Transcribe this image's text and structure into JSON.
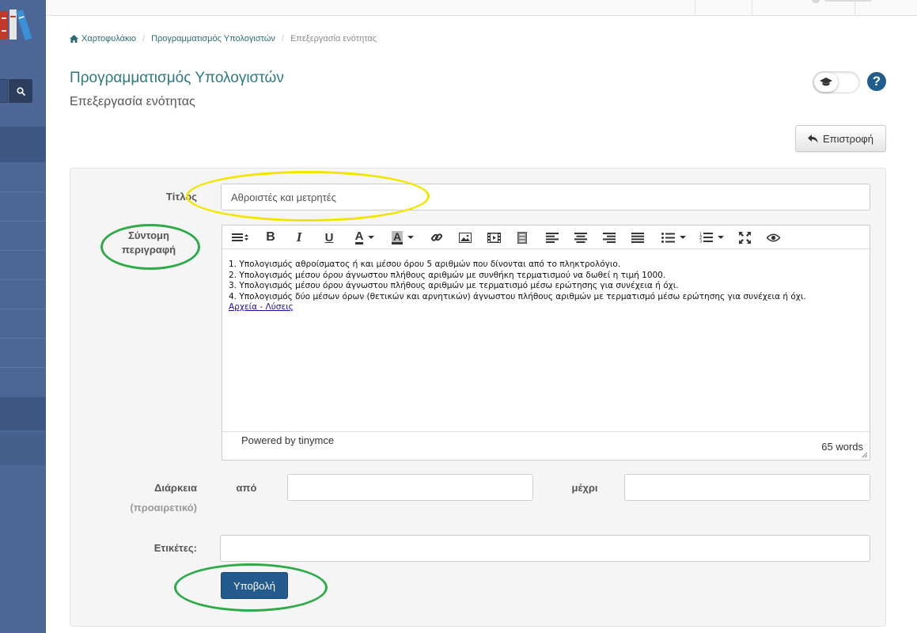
{
  "breadcrumb": {
    "home": "Χαρτοφυλάκιο",
    "course": "Προγραμματισμός Υπολογιστών",
    "current": "Επεξεργασία ενότητας"
  },
  "page": {
    "title": "Προγραμματισμός Υπολογιστών",
    "subtitle": "Επεξεργασία ενότητας"
  },
  "actions": {
    "back_label": "Επιστροφή",
    "help_label": "?"
  },
  "form": {
    "title_label": "Τίτλος",
    "title_value": "Αθροιστές και μετρητές",
    "description_label_line1": "Σύντομη",
    "description_label_line2": "περιγραφή",
    "duration_label": "Διάρκεια",
    "duration_optional": "(προαιρετικό)",
    "from_label": "από",
    "to_label": "μέχρι",
    "from_value": "",
    "to_value": "",
    "tags_label": "Ετικέτες:",
    "tags_value": "",
    "submit_label": "Υποβολή"
  },
  "editor": {
    "lines": [
      "1. Υπολογισμός αθροίσματος ή και μέσου όρου 5 αριθμών που δίνονται από το πληκτρολόγιο.",
      "2. Υπολογισμός μέσου όρου άγνωστου πλήθους αριθμών με  συνθήκη τερματισμού να δωθεί η τιμή 1000.",
      "3. Υπολογισμός μέσου όρου άγνωστου πλήθους αριθμών με τερματισμό μέσω ερώτησης για συνέχεια ή όχι.",
      "4. Υπολογισμός δύο μέσων όρων (θετικών και αρνητικών) άγνωστου πλήθους αριθμών με τερματισμό μέσω ερώτησης για συνέχεια ή όχι."
    ],
    "link_text": "Αρχεία - Λύσεις",
    "powered_by": "Powered by tinymce",
    "word_count": "65 words",
    "toolbar_text": {
      "bold": "B",
      "italic": "I",
      "underline": "U",
      "font_color": "A",
      "bg_color": "A"
    },
    "toolbar_icons": [
      "formats-icon",
      "bold-icon",
      "italic-icon",
      "underline-icon",
      "text-color-icon",
      "background-color-icon",
      "link-icon",
      "image-icon",
      "media-icon",
      "document-icon",
      "align-left-icon",
      "align-center-icon",
      "align-right-icon",
      "align-justify-icon",
      "bullet-list-icon",
      "numbered-list-icon",
      "fullscreen-icon",
      "preview-icon"
    ]
  },
  "colors": {
    "sidebar": "#4c6796",
    "title_teal": "#2f7a82",
    "primary_button": "#235b8f",
    "annotation_yellow": "#f2e600",
    "annotation_green": "#2eaa48"
  }
}
